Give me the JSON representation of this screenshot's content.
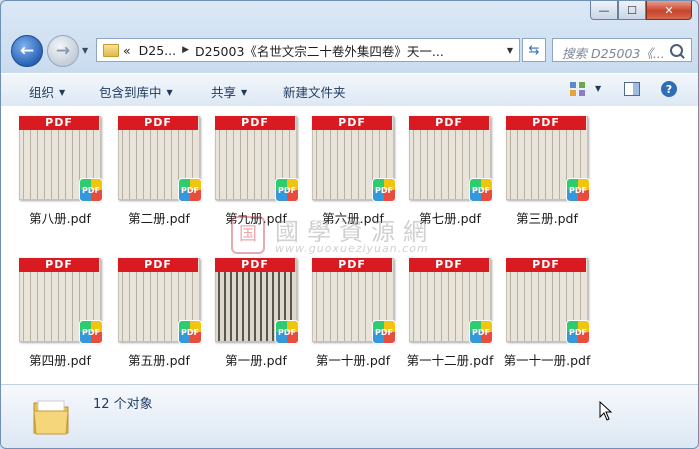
{
  "window": {
    "controls": {
      "minimize": "—",
      "maximize": "☐",
      "close": "✕"
    }
  },
  "navigation": {
    "back_icon": "arrow-left-icon",
    "forward_icon": "arrow-right-icon",
    "address_parts": [
      "«",
      "D25...",
      "D25003《名世文宗二十卷外集四卷》天一..."
    ],
    "search_placeholder": "搜索 D25003《..."
  },
  "toolbar": {
    "organize": "组织",
    "include_in_library": "包含到库中",
    "share": "共享",
    "new_folder": "新建文件夹"
  },
  "files": [
    {
      "name": "第八册.pdf",
      "band": "PDF",
      "badge": "PDF"
    },
    {
      "name": "第二册.pdf",
      "band": "PDF",
      "badge": "PDF"
    },
    {
      "name": "第九册.pdf",
      "band": "PDF",
      "badge": "PDF"
    },
    {
      "name": "第六册.pdf",
      "band": "PDF",
      "badge": "PDF"
    },
    {
      "name": "第七册.pdf",
      "band": "PDF",
      "badge": "PDF"
    },
    {
      "name": "第三册.pdf",
      "band": "PDF",
      "badge": "PDF"
    },
    {
      "name": "第四册.pdf",
      "band": "PDF",
      "badge": "PDF"
    },
    {
      "name": "第五册.pdf",
      "band": "PDF",
      "badge": "PDF"
    },
    {
      "name": "第一册.pdf",
      "band": "PDF",
      "badge": "PDF"
    },
    {
      "name": "第一十册.pdf",
      "band": "PDF",
      "badge": "PDF"
    },
    {
      "name": "第一十二册.pdf",
      "band": "PDF",
      "badge": "PDF"
    },
    {
      "name": "第一十一册.pdf",
      "band": "PDF",
      "badge": "PDF"
    }
  ],
  "watermark": {
    "seal": "国",
    "chinese": "國學資源網",
    "url": "www.guoxueziyuan.com"
  },
  "status": {
    "count": "12 个对象"
  }
}
